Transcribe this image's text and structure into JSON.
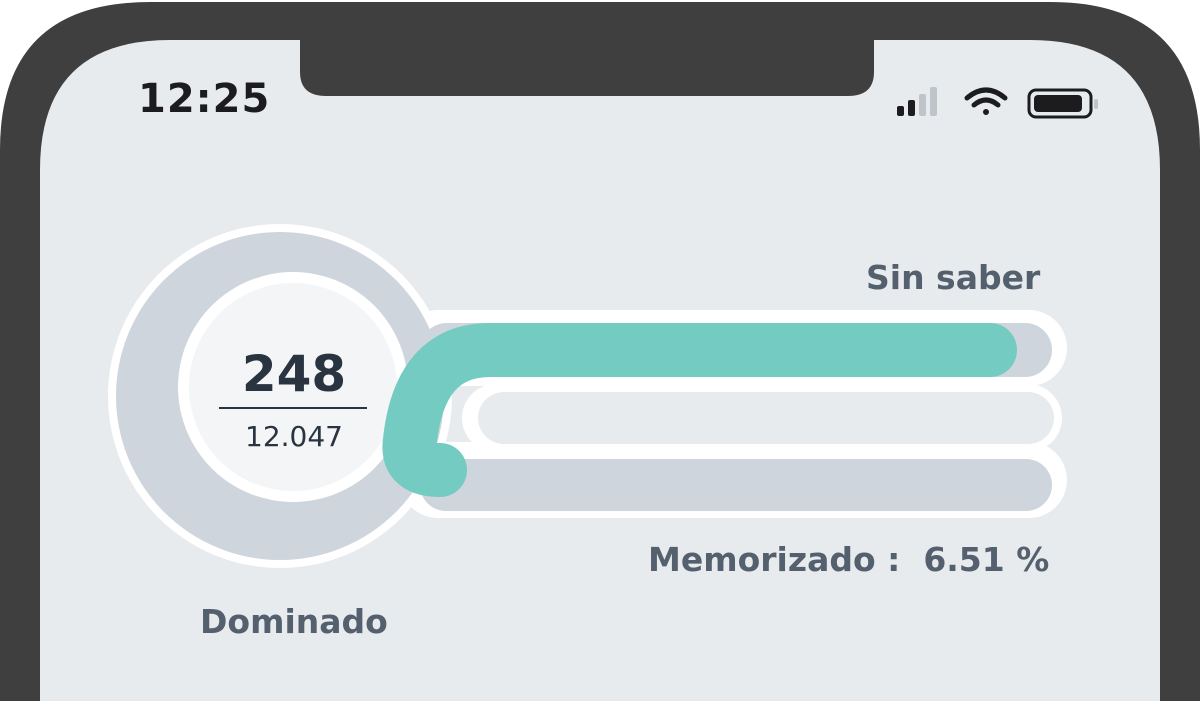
{
  "status_bar": {
    "time": "12:25",
    "icons": [
      "signal-icon",
      "wifi-icon",
      "battery-icon"
    ]
  },
  "progress_widget": {
    "mastered_count": "248",
    "total_count": "12.047",
    "unknown_label": "Sin saber",
    "memorized_label": "Memorizado :",
    "memorized_value": "6.51 %",
    "mastered_label": "Dominado",
    "memorized_fraction": 0.0651
  },
  "colors": {
    "frame": "#3f3f3f",
    "screen_bg": "#e8ebee",
    "track": "#cfd5dc",
    "accent": "#73cbc1",
    "text": "#55606e"
  }
}
